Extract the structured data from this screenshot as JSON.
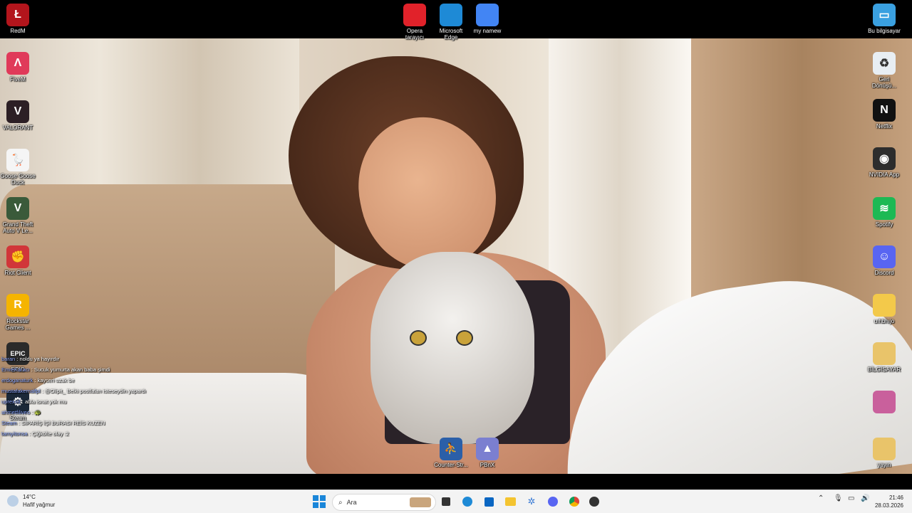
{
  "desktop": {
    "top_icons": [
      {
        "label": "Opera\ntarayıcı",
        "icon": "opera-icon",
        "color": "#e1222a"
      },
      {
        "label": "Microsoft\nEdge",
        "icon": "edge-icon",
        "color": "#1e8ad6"
      },
      {
        "label": "my namew",
        "icon": "chrome-icon",
        "color": "#4285f4"
      }
    ],
    "left_icons": [
      {
        "label": "RedM",
        "icon": "redm-icon",
        "color": "#b3151c",
        "glyph": "Ł"
      },
      {
        "label": "FiveM",
        "icon": "fivem-icon",
        "color": "#e03a5a",
        "glyph": "Λ"
      },
      {
        "label": "VALORANT",
        "icon": "valorant-icon",
        "color": "#2c1f25",
        "glyph": "V"
      },
      {
        "label": "Goose Goose\nDuck",
        "icon": "goose-icon",
        "color": "#f5f5f5",
        "glyph": "🪿"
      },
      {
        "label": "Grand Theft\nAuto V Le...",
        "icon": "gta-icon",
        "color": "#3a5a3a",
        "glyph": "V"
      },
      {
        "label": "Riot Client",
        "icon": "riot-icon",
        "color": "#d13639",
        "glyph": "✊"
      },
      {
        "label": "Rockstar\nGames ...",
        "icon": "rockstar-icon",
        "color": "#f5b400",
        "glyph": "R"
      },
      {
        "label": "EPIC",
        "icon": "epic-icon",
        "color": "#2a2a2a",
        "glyph": "EPIC"
      },
      {
        "label": "Steam",
        "icon": "steam-icon",
        "color": "#1b2838",
        "glyph": "⚙"
      }
    ],
    "right_icons": [
      {
        "label": "Bu bilgisayar",
        "icon": "computer-icon",
        "color": "#3aa0e0",
        "glyph": "▭"
      },
      {
        "label": "Geri\nDönüşü...",
        "icon": "recycle-bin-icon",
        "color": "#e8eef3",
        "glyph": "♻"
      },
      {
        "label": "Netflix",
        "icon": "netflix-icon",
        "color": "#111",
        "glyph": "N"
      },
      {
        "label": "NVIDIA App",
        "icon": "nvidia-icon",
        "color": "#2d2d2d",
        "glyph": "◉"
      },
      {
        "label": "Spotify",
        "icon": "spotify-icon",
        "color": "#1db954",
        "glyph": "≋"
      },
      {
        "label": "Discord",
        "icon": "discord-icon",
        "color": "#5865f2",
        "glyph": "☺"
      },
      {
        "label": "uıhbhıjo",
        "icon": "folder-icon",
        "color": "#f3c94a",
        "glyph": ""
      },
      {
        "label": "BİLGİSAYAR",
        "icon": "folder-image-icon",
        "color": "#e9c46a",
        "glyph": ""
      },
      {
        "label": "",
        "icon": "image-file-icon",
        "color": "#c9609c",
        "glyph": ""
      },
      {
        "label": "yayın",
        "icon": "folder-yayin-icon",
        "color": "#e9c46a",
        "glyph": ""
      }
    ],
    "bottom_icons": [
      {
        "label": "Counter-Str...",
        "icon": "counter-strike-icon",
        "color": "#2b5fa8",
        "glyph": "⛹"
      },
      {
        "label": "PBnX",
        "icon": "pbnx-icon",
        "color": "#7b7fd0",
        "glyph": "▲"
      }
    ]
  },
  "chat": [
    {
      "user": "baran",
      "text": ": noldu ya hayırdır"
    },
    {
      "user": "EmreKaracı",
      "text": ": Sucuk yumurta akan baba şimdi"
    },
    {
      "user": "erdoganaturk",
      "text": ": kayseri uzak be"
    },
    {
      "user": "mustafakemalfpl",
      "text": ": @Olipit_ Belki postfalan isteseydin yapardı"
    },
    {
      "user": "uprexxd",
      "text": ": abla isnat yok mu"
    },
    {
      "user": "ahmetfiliveo",
      "text": ": 🐢"
    },
    {
      "user": "Steam",
      "text": ": SİPARİŞ İŞİ BURASI REİS KUZEN"
    },
    {
      "user": "tarnyitonsa",
      "text": ": Çiğköfte olay :2"
    }
  ],
  "taskbar": {
    "weather_temp": "14°C",
    "weather_desc": "Hafif yağmur",
    "search_placeholder": "Ara",
    "time": "21:46",
    "date": "28.03.2026",
    "accent": "#0067c0"
  }
}
